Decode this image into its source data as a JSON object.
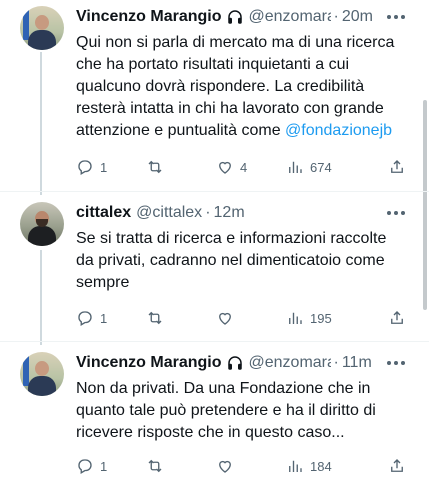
{
  "tweets": [
    {
      "name": "Vincenzo Marangio",
      "handle": "@enzomara",
      "separator": "·",
      "time": "20m",
      "text_lines": [
        "Qui non si parla di mercato ma di una ricerca",
        "che ha portato risultati inquietanti a cui",
        "qualcuno dovrà rispondere. La credibilità",
        "resterà intatta in chi ha lavorato con grande"
      ],
      "last_line_prefix": "attenzione e puntualità come ",
      "mention": "@fondazionejb",
      "replies": "1",
      "retweets": "",
      "likes": "4",
      "views": "674",
      "badge_icon": "headphones-icon"
    },
    {
      "name": "cittalex",
      "handle": "@cittalex",
      "separator": "·",
      "time": "12m",
      "text_lines": [
        "Se si tratta di ricerca e informazioni raccolte",
        "da privati, cadranno nel dimenticatoio come",
        "sempre"
      ],
      "replies": "1",
      "retweets": "",
      "likes": "",
      "views": "195"
    },
    {
      "name": "Vincenzo Marangio",
      "handle": "@enzomara",
      "separator": "·",
      "time": "11m",
      "text_lines": [
        "Non da privati. Da una Fondazione che in",
        "quanto tale può pretendere e ha il diritto di",
        "ricevere risposte che in questo caso..."
      ],
      "replies": "1",
      "retweets": "",
      "likes": "",
      "views": "184",
      "badge_icon": "headphones-icon"
    }
  ],
  "colors": {
    "link": "#1d9bf0",
    "muted": "#536471",
    "text": "#0f1419"
  }
}
